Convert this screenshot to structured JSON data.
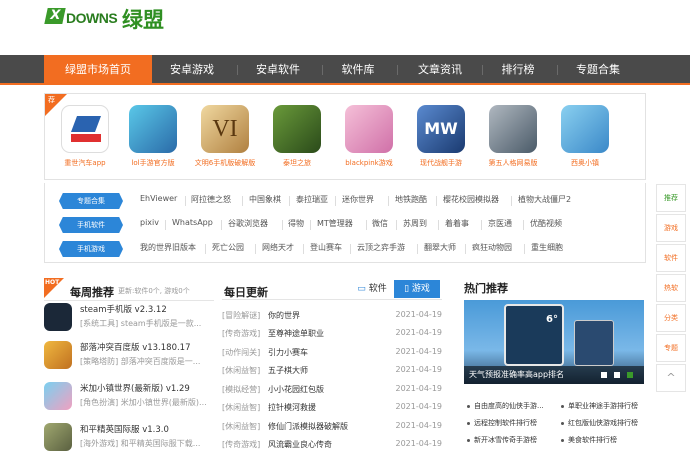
{
  "header": {
    "logo_text": "DOWNS",
    "logo_cn": "绿盟",
    "logo_x": "X"
  },
  "nav": {
    "items": [
      "绿盟市场首页",
      "安卓游戏",
      "安卓软件",
      "软件库",
      "文章资讯",
      "排行榜",
      "专题合集"
    ]
  },
  "apps": {
    "hot_tag": "荐",
    "items": [
      {
        "name": "重世汽车app",
        "color": "#2a63b0"
      },
      {
        "name": "lol手游官方版",
        "color": "#3aa8c8"
      },
      {
        "name": "文明6手机版破解版",
        "color": "#c89a3a"
      },
      {
        "name": "泰坦之旅",
        "color": "#4d7a2a"
      },
      {
        "name": "blackpink游戏",
        "color": "#e08cc0"
      },
      {
        "name": "现代战舰手游",
        "color": "#2a5aa0"
      },
      {
        "name": "第五人格网易版",
        "color": "#6a7a88"
      },
      {
        "name": "西奥小镇",
        "color": "#4aa0d8"
      }
    ]
  },
  "tags": {
    "rows": [
      {
        "label": "专题合集",
        "links": [
          "EhViewer",
          "阿拉德之怒",
          "中国象棋",
          "泰拉瑞亚",
          "迷你世界",
          "地铁跑酷",
          "樱花校园模拟器",
          "植物大战僵尸2"
        ]
      },
      {
        "label": "手机软件",
        "links": [
          "pixiv",
          "WhatsApp",
          "谷歌浏览器",
          "得物",
          "MT管理器",
          "微信",
          "苏周到",
          "着着事",
          "京医通",
          "优酷视频"
        ]
      },
      {
        "label": "手机游戏",
        "links": [
          "我的世界旧版本",
          "死亡公园",
          "网络天才",
          "登山赛车",
          "云顶之弈手游",
          "翻翠大师",
          "疯狂动物园",
          "重生细胞"
        ]
      }
    ]
  },
  "sidebar": {
    "items": [
      "推荐",
      "游戏",
      "软件",
      "热软",
      "分类",
      "专题",
      "^"
    ]
  },
  "weekly": {
    "title": "每周推荐",
    "tag": "HOT",
    "subtitle": "更新:软件0个, 游戏0个",
    "items": [
      {
        "title": "steam手机版 v2.3.12",
        "desc": "[系统工具] steam手机版是一款...",
        "color": "#1b2838"
      },
      {
        "title": "部落冲突百度版 v13.180.17",
        "desc": "[策略塔防] 部落冲突百度版是一...",
        "color": "#e8a030"
      },
      {
        "title": "米加小镇世界(最新版) v1.29",
        "desc": "[角色扮演] 米加小镇世界(最新版)...",
        "color": "#58b8e8"
      },
      {
        "title": "和平精英国际服 v1.3.0",
        "desc": "[海外游戏] 和平精英国际服下载...",
        "color": "#7a8a5a"
      }
    ]
  },
  "daily": {
    "title": "每日更新",
    "tab_soft": "软件",
    "tab_game": "游戏",
    "items": [
      {
        "cat": "[冒险解谜]",
        "name": "你的世界",
        "date": "2021-04-19"
      },
      {
        "cat": "[传奇游戏]",
        "name": "至尊神途单职业",
        "date": "2021-04-19"
      },
      {
        "cat": "[动作闯关]",
        "name": "引力小赛车",
        "date": "2021-04-19"
      },
      {
        "cat": "[休闲益智]",
        "name": "五子棋大师",
        "date": "2021-04-19"
      },
      {
        "cat": "[模拟经营]",
        "name": "小小花园红包版",
        "date": "2021-04-19"
      },
      {
        "cat": "[休闲益智]",
        "name": "拉针模河救援",
        "date": "2021-04-19"
      },
      {
        "cat": "[休闲益智]",
        "name": "修仙门派模拟器破解版",
        "date": "2021-04-19"
      },
      {
        "cat": "[传奇游戏]",
        "name": "风流霸业良心传奇",
        "date": "2021-04-19"
      }
    ]
  },
  "hot": {
    "title": "热门推荐",
    "banner_caption": "天气预报准确率高app排名",
    "banner_temp": "6°",
    "links": [
      "自由度高的仙侠手游...",
      "单职业神途手游排行榜",
      "远程控制软件排行榜",
      "红包版仙侠游戏排行榜",
      "新开冰雪传奇手游榜",
      "美食软件排行榜"
    ]
  }
}
